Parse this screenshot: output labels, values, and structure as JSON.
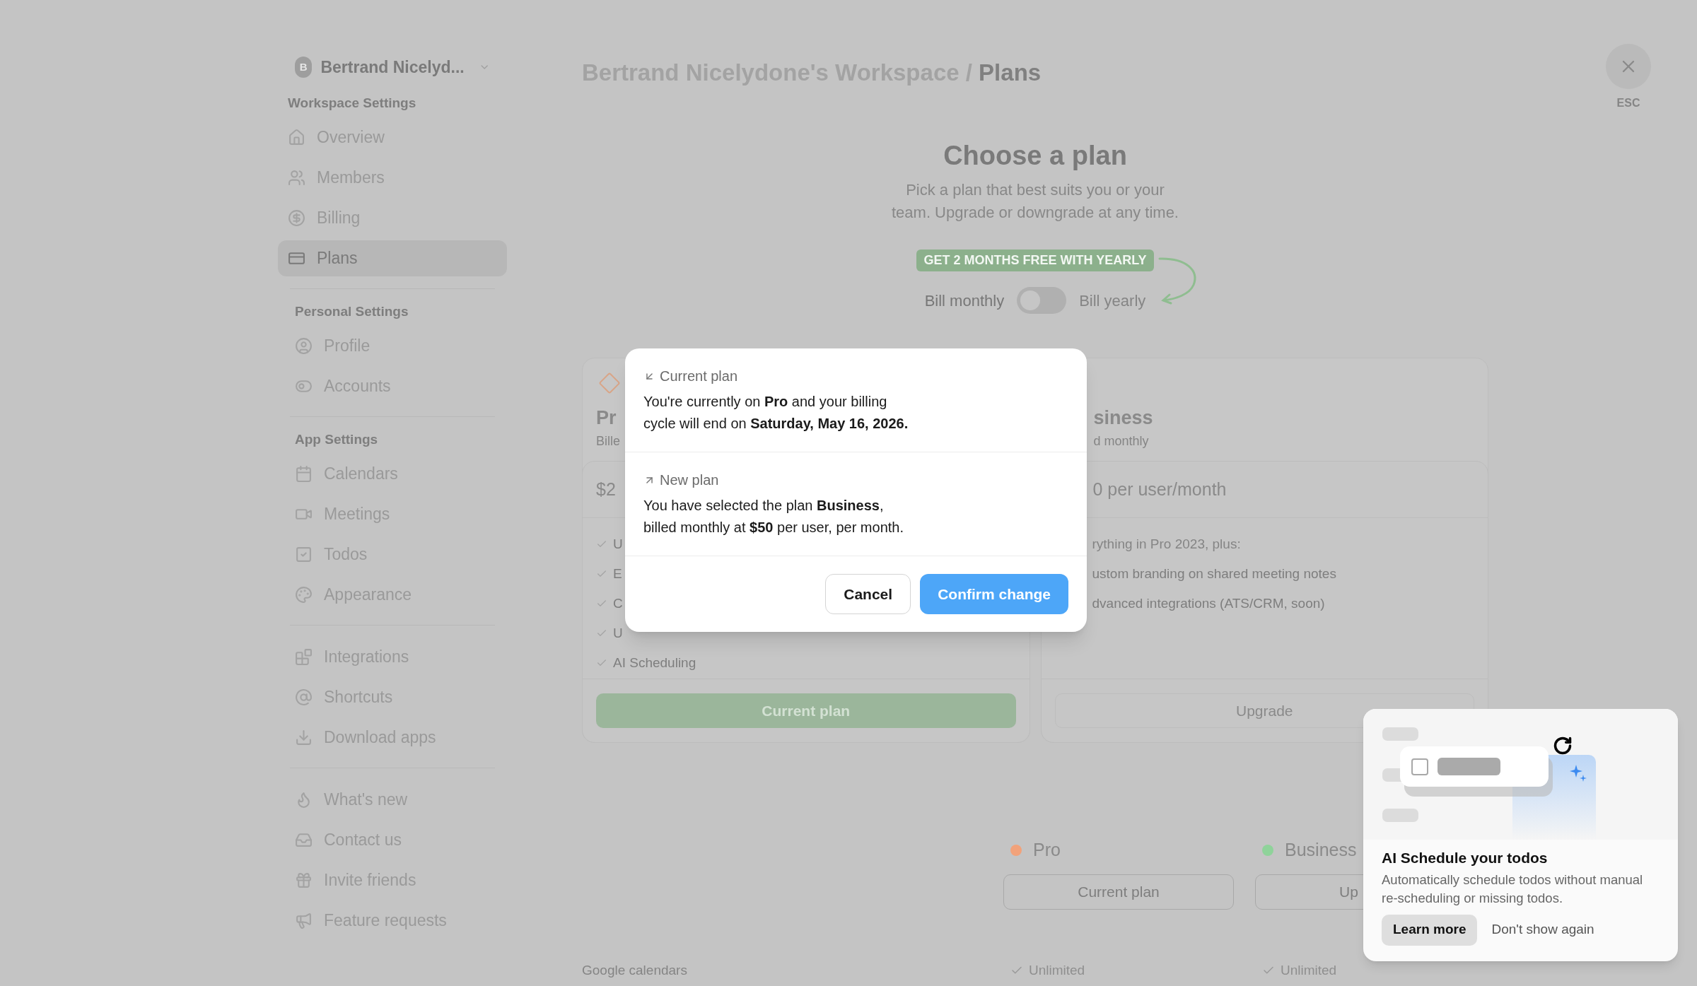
{
  "sidebar": {
    "workspace": {
      "initial": "B",
      "name": "Bertrand Nicelyd..."
    },
    "sections": [
      {
        "title": "Workspace Settings",
        "items": [
          {
            "label": "Overview",
            "selected": false
          },
          {
            "label": "Members",
            "selected": false
          },
          {
            "label": "Billing",
            "selected": false
          },
          {
            "label": "Plans",
            "selected": true
          }
        ]
      },
      {
        "title": "Personal Settings",
        "items": [
          {
            "label": "Profile",
            "selected": false
          },
          {
            "label": "Accounts",
            "selected": false
          }
        ]
      },
      {
        "title": "App Settings",
        "items": [
          {
            "label": "Calendars",
            "selected": false
          },
          {
            "label": "Meetings",
            "selected": false
          },
          {
            "label": "Todos",
            "selected": false
          },
          {
            "label": "Appearance",
            "selected": false
          }
        ]
      },
      {
        "items": [
          {
            "label": "Integrations",
            "selected": false
          },
          {
            "label": "Shortcuts",
            "selected": false
          },
          {
            "label": "Download apps",
            "selected": false
          }
        ]
      },
      {
        "items": [
          {
            "label": "What's new",
            "selected": false
          },
          {
            "label": "Contact us",
            "selected": false
          },
          {
            "label": "Invite friends",
            "selected": false
          },
          {
            "label": "Feature requests",
            "selected": false
          }
        ]
      }
    ]
  },
  "header": {
    "breadcrumb": "Bertrand Nicelydone's Workspace /",
    "current": "Plans"
  },
  "close": {
    "label": "ESC"
  },
  "intro": {
    "title": "Choose a plan",
    "subtitle": "Pick a plan that best suits you or your team. Upgrade or downgrade at any time."
  },
  "billing": {
    "promo": "GET 2 MONTHS FREE WITH YEARLY",
    "monthly_label": "Bill monthly",
    "yearly_label": "Bill yearly",
    "yearly": false
  },
  "plan_cards": [
    {
      "name": "Pr",
      "billing": "Bille",
      "price": "$2",
      "current": true,
      "features": [
        "U",
        "E",
        "C",
        "U",
        "AI Scheduling"
      ],
      "button": "Current plan"
    },
    {
      "name": "siness",
      "billing": "d monthly",
      "price": "0 per user/month",
      "current": false,
      "intro": "rything in Pro 2023, plus:",
      "features": [
        "ustom branding on shared meeting notes",
        "dvanced integrations (ATS/CRM, soon)"
      ],
      "button": "Upgrade"
    }
  ],
  "comparison": {
    "columns": [
      {
        "name": "Pro",
        "color": "#f2a27a",
        "button": "Current plan"
      },
      {
        "name": "Business",
        "color": "#8fd39a",
        "button": "Up"
      }
    ],
    "rows": [
      {
        "label": "Google calendars",
        "values": [
          "Unlimited",
          "Unlimited"
        ]
      }
    ]
  },
  "dialog": {
    "sections": [
      {
        "kind": "current",
        "heading": "Current plan",
        "lines": [
          "You're currently on **Pro** and your billing",
          "cycle will end on **Saturday, May 16, 2026.**"
        ]
      },
      {
        "kind": "new",
        "heading": "New plan",
        "lines": [
          "You have selected the plan **Business**,",
          "billed monthly at **$50** per user, per month."
        ]
      }
    ],
    "buttons": [
      {
        "label": "Cancel",
        "kind": "secondary"
      },
      {
        "label": "Confirm change",
        "kind": "primary"
      }
    ]
  },
  "popup": {
    "title": "AI Schedule your todos",
    "text": "Automatically schedule todos without manual re-scheduling or missing todos.",
    "buttons": [
      {
        "label": "Learn more",
        "kind": "secondary"
      },
      {
        "label": "Don't show again",
        "kind": "plain"
      }
    ]
  }
}
